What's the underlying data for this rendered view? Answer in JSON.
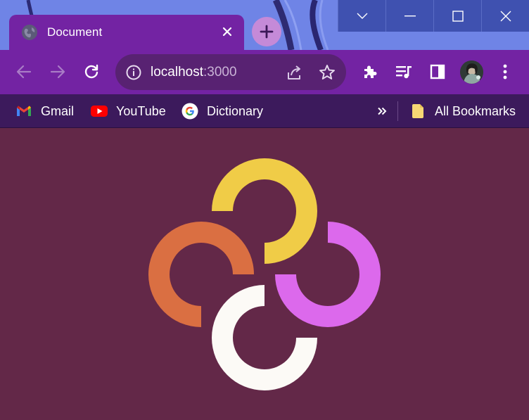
{
  "tab": {
    "title": "Document"
  },
  "address_bar": {
    "host": "localhost",
    "port": ":3000"
  },
  "bookmarks": [
    {
      "label": "Gmail",
      "icon": "gmail-icon"
    },
    {
      "label": "YouTube",
      "icon": "youtube-icon"
    },
    {
      "label": "Dictionary",
      "icon": "google-icon"
    }
  ],
  "all_bookmarks": {
    "label": "All Bookmarks",
    "icon": "folder-icon"
  },
  "colors": {
    "page_background": "#632848",
    "browser_frame": "#7323a3",
    "bookmarks_bar": "#3c1a5c",
    "logo_yellow": "#f0cc47",
    "logo_orange": "#da6f42",
    "logo_pink": "#dc69ec",
    "logo_white": "#fcfaf6"
  },
  "logo": {
    "rings": [
      "yellow",
      "pink",
      "white",
      "orange"
    ]
  }
}
